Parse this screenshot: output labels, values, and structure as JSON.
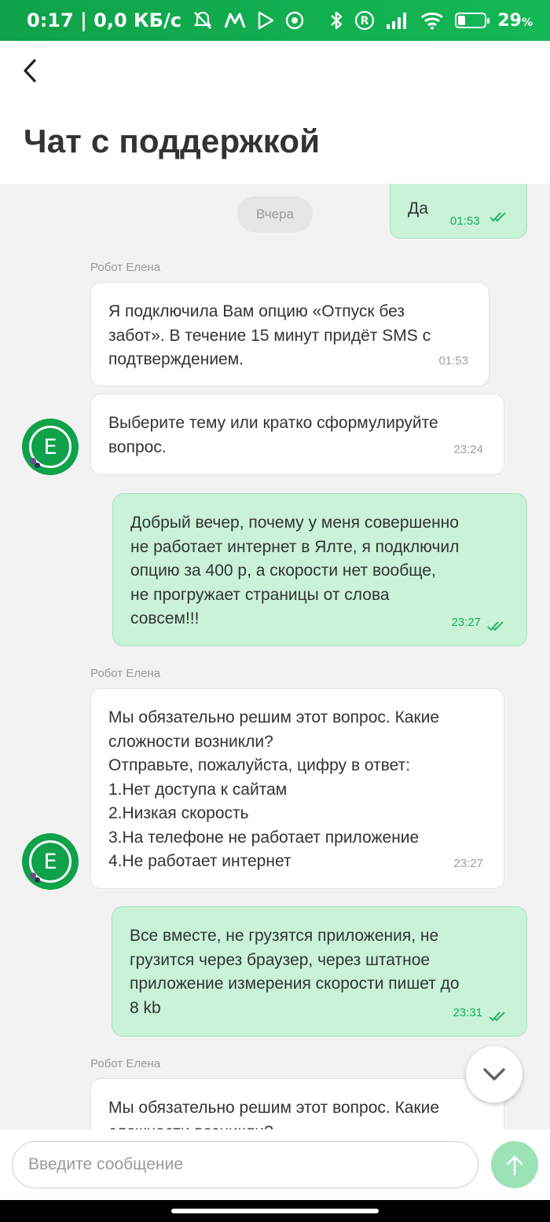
{
  "status_bar": {
    "time_speed": "0:17 | 0,0 КБ/с",
    "battery_percent": "29",
    "battery_level": 0.29,
    "icons": [
      "mute-icon",
      "metro-icon",
      "play-icon",
      "chrome-icon",
      "bluetooth-icon",
      "registered-icon",
      "signal-icon",
      "wifi-icon",
      "battery-icon"
    ]
  },
  "header": {
    "back_icon": "back-arrow-icon",
    "title": "Чат с поддержкой"
  },
  "chat": {
    "date_separator": "Вчера",
    "messages": [
      {
        "direction": "out",
        "text": "Да",
        "time": "01:53",
        "status_icon": "double-check-icon"
      },
      {
        "direction": "in",
        "sender": "Робот Елена",
        "text": "Я подключила Вам опцию «Отпуск без\nзабот». В течение 15 минут придёт SMS с\nподтверждением.",
        "time": "01:53"
      },
      {
        "direction": "in",
        "text": "Выберите тему или кратко сформулируйте\nвопрос.",
        "time": "23:24",
        "avatar_letter": "E"
      },
      {
        "direction": "out",
        "text": "Добрый вечер, почему у меня совершенно\nне работает интернет в Ялте, я подключил\nопцию за 400 р, а скорости нет вообще,\nне прогружает страницы от слова\nсовсем!!!",
        "time": "23:27",
        "status_icon": "double-check-icon"
      },
      {
        "direction": "in",
        "sender": "Робот Елена",
        "text": "Мы обязательно решим этот вопрос. Какие\nсложности возникли?\nОтправьте, пожалуйста, цифру в ответ:\n1.Нет доступа к сайтам\n2.Низкая скорость\n3.На телефоне не работает приложение\n4.Не работает интернет",
        "time": "23:27",
        "avatar_letter": "E"
      },
      {
        "direction": "out",
        "text": "Все вместе, не грузятся приложения, не\nгрузится через браузер, через штатное\nприложение измерения скорости пишет до\n8 kb",
        "time": "23:31",
        "status_icon": "double-check-icon"
      },
      {
        "direction": "in",
        "sender": "Робот Елена",
        "text": "Мы обязательно решим этот вопрос. Какие\nсложности возникли?",
        "time": ""
      }
    ]
  },
  "scroll_down_icon": "chevron-down-icon",
  "composer": {
    "placeholder": "Введите сообщение",
    "value": "",
    "send_icon": "arrow-up-icon"
  },
  "colors": {
    "brand_green": "#0fa24a",
    "outgoing_bubble": "#c9f2d9",
    "incoming_bubble": "#ffffff",
    "send_button": "#9be3b6"
  }
}
